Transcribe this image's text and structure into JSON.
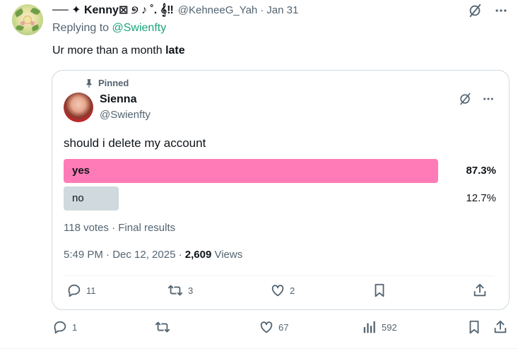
{
  "reply": {
    "display_name": "── ✦ Kenny⊠ ୭ ♪ ˚. 𝄞‼",
    "handle": "@KehneeG_Yah",
    "separator": "·",
    "date": "Jan 31",
    "replying_prefix": "Replying to ",
    "replying_to": "@Swienfty",
    "text_plain": "Ur more than a month ",
    "text_bold": "late",
    "stats": {
      "replies": "1",
      "reposts": "",
      "likes": "67",
      "views": "592"
    }
  },
  "quote": {
    "pinned_label": "Pinned",
    "name": "Sienna",
    "handle": "@Swienfty",
    "text": "should i delete my account",
    "poll": {
      "options": [
        {
          "label": "yes",
          "percent": "87.3%",
          "fraction": 0.873,
          "winner": true
        },
        {
          "label": "no",
          "percent": "12.7%",
          "fraction": 0.127,
          "winner": false
        }
      ],
      "meta": "118 votes · Final results"
    },
    "time": "5:49 PM · Dec 12, 2025 · ",
    "views_count": "2,609",
    "views_label": " Views",
    "stats": {
      "replies": "11",
      "reposts": "3",
      "likes": "2"
    }
  },
  "colors": {
    "winner_bar": "#ff7bb7",
    "loser_bar": "#cfd9de",
    "mention": "#1aa37a",
    "muted": "#536471"
  },
  "icons": [
    "grok-icon",
    "more-icon",
    "pin-icon",
    "reply-icon",
    "repost-icon",
    "like-icon",
    "views-icon",
    "bookmark-icon",
    "share-icon"
  ]
}
